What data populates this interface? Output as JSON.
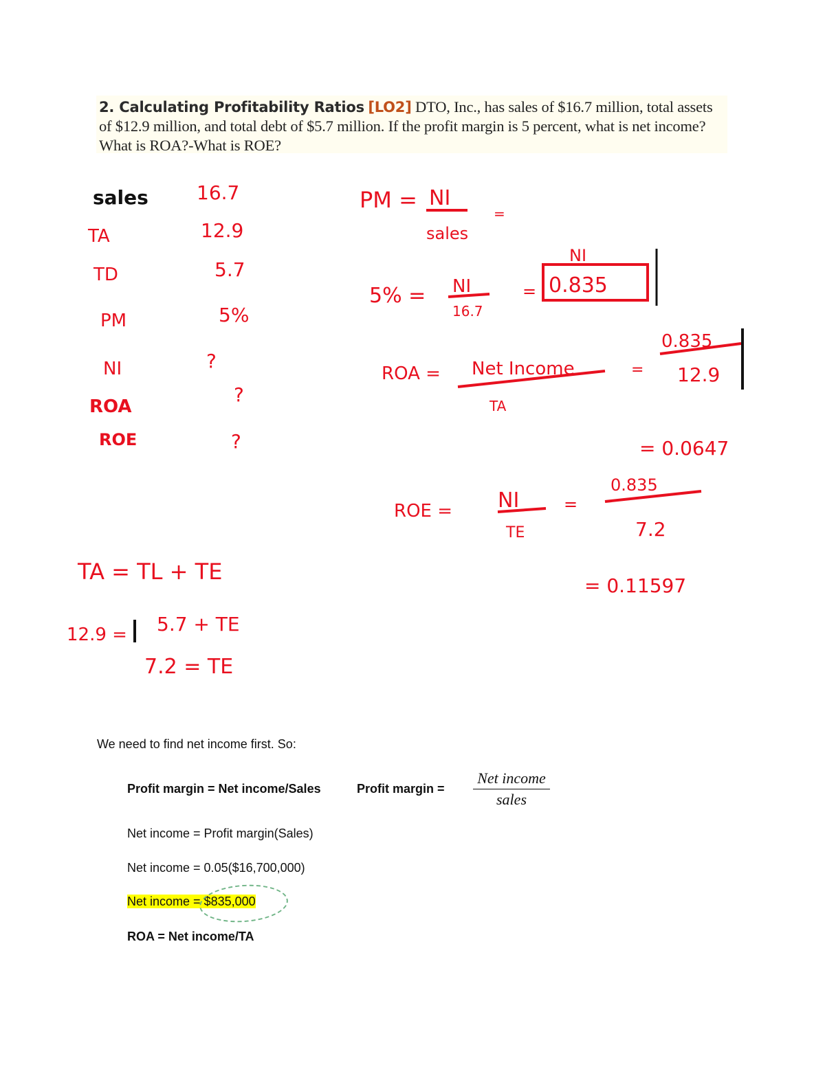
{
  "question": {
    "number_title": "2. Calculating Profitability Ratios",
    "learning_objective": "[LO2]",
    "text": "DTO, Inc., has sales of $16.7 million, total assets of $12.9 million, and total debt of $5.7 million. If the profit margin is 5 percent, what is net income? What is ROA?-What is ROE?"
  },
  "handwritten": {
    "given_table": [
      {
        "label": "sales",
        "value": "16.7"
      },
      {
        "label": "TA",
        "value": "12.9"
      },
      {
        "label": "TD",
        "value": "5.7"
      },
      {
        "label": "PM",
        "value": "5%"
      },
      {
        "label": "NI",
        "value": "?"
      },
      {
        "label": "ROA",
        "value": "?"
      },
      {
        "label": "ROE",
        "value": "?"
      }
    ],
    "pm_formula": {
      "lhs": "PM =",
      "numerator": "NI",
      "denominator": "sales",
      "trail": "="
    },
    "pm_solve": {
      "lhs": "5% =",
      "numerator": "NI",
      "denominator": "16.7",
      "eq": "=",
      "result_label": "NI",
      "result": "0.835"
    },
    "roa_formula": {
      "lhs": "ROA =",
      "numerator": "Net Income",
      "denominator": "TA",
      "eq": "=",
      "value_num": "0.835",
      "value_den": "12.9",
      "result": "= 0.0647"
    },
    "roe_formula": {
      "lhs": "ROE =",
      "numerator": "NI",
      "denominator": "TE",
      "eq": "=",
      "value_num": "0.835",
      "value_den": "7.2",
      "result": "= 0.11597"
    },
    "equity_calc": {
      "line1": "TA = TL + TE",
      "line2_lhs": "12.9 =",
      "line2_rhs": "5.7 + TE",
      "line3": "7.2 = TE"
    }
  },
  "solution": {
    "intro": "We need to find net income first. So:",
    "pm_def": "Profit margin = Net income/Sales",
    "pm_label": "Profit margin =",
    "pm_frac_num": "Net income",
    "pm_frac_den": "sales",
    "ni_formula": "Net income = Profit margin(Sales)",
    "ni_calc": "Net income = 0.05($16,700,000)",
    "ni_result_prefix": "Net income = ",
    "ni_result_value": "$835,000",
    "roa_def": "ROA = Net income/TA"
  },
  "colors": {
    "ink": "#e8101f",
    "highlight": "#ffff00",
    "question_bg": "#fffdf0",
    "lo_tag": "#c0501a",
    "circle": "#6fb486"
  }
}
